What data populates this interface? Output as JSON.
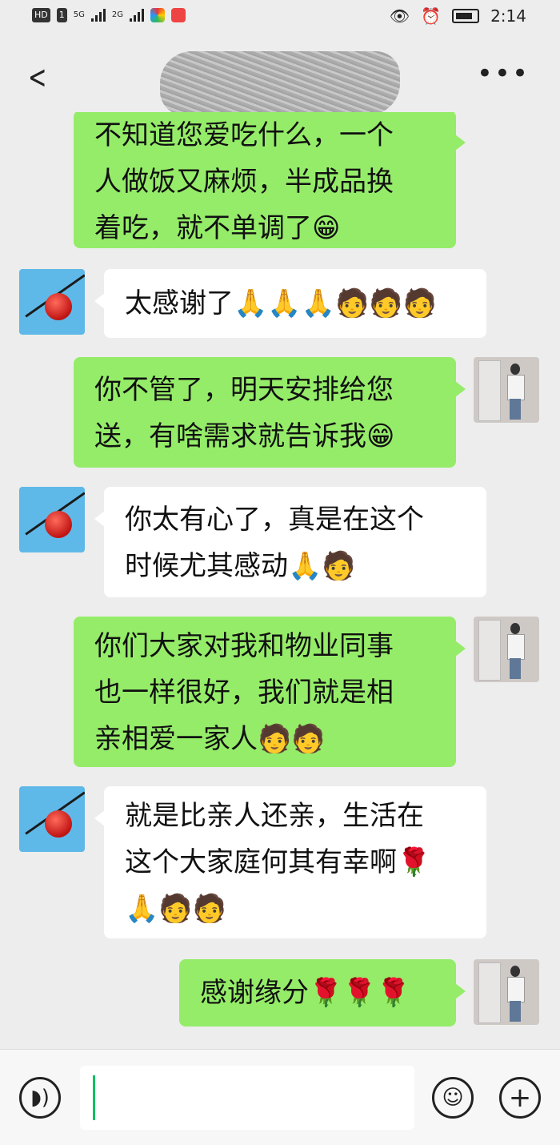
{
  "status_bar": {
    "left_badges": [
      "HD",
      "1"
    ],
    "network_1": "5G",
    "network_2": "2G",
    "time": "2:14"
  },
  "header": {
    "back_icon": "chevron-left-icon",
    "more_icon": "ellipsis-icon"
  },
  "messages": [
    {
      "side": "right",
      "text": "不知道您爱吃什么，一个人做饭又麻烦，半成品换着吃，就不单调了😁"
    },
    {
      "side": "left",
      "text": "太感谢了🙏🙏🙏🧑🧑🧑"
    },
    {
      "side": "right",
      "text": "你不管了，明天安排给您送，有啥需求就告诉我😁"
    },
    {
      "side": "left",
      "text": "你太有心了，真是在这个时候尤其感动🙏🧑"
    },
    {
      "side": "right",
      "text": "你们大家对我和物业同事也一样很好，我们就是相亲相爱一家人🧑🧑"
    },
    {
      "side": "left",
      "text": "就是比亲人还亲，生活在这个大家庭何其有幸啊🌹🙏🧑🧑"
    },
    {
      "side": "right",
      "text": "感谢缘分🌹🌹🌹"
    }
  ],
  "lines": {
    "m0": [
      "不知道您爱吃什么，一个",
      "人做饭又麻烦，半成品换",
      "着吃，就不单调了😁"
    ],
    "m1": [
      "太感谢了🙏🙏🙏🧑🧑🧑"
    ],
    "m2": [
      "你不管了，明天安排给您",
      "送，有啥需求就告诉我😁"
    ],
    "m3": [
      "你太有心了，真是在这个",
      "时候尤其感动🙏🧑"
    ],
    "m4": [
      "你们大家对我和物业同事",
      "也一样很好，我们就是相",
      "亲相爱一家人🧑🧑"
    ],
    "m5": [
      "就是比亲人还亲，生活在",
      "这个大家庭何其有幸啊🌹",
      "🙏🧑🧑"
    ],
    "m6": [
      "感谢缘分🌹🌹🌹"
    ]
  },
  "input_bar": {
    "voice_icon": "voice-icon",
    "emoji_icon": "emoji-icon",
    "plus_icon": "plus-icon",
    "text": ""
  },
  "colors": {
    "background": "#ededed",
    "bubble_self": "#95ec69",
    "bubble_other": "#ffffff",
    "caret": "#07c160"
  }
}
